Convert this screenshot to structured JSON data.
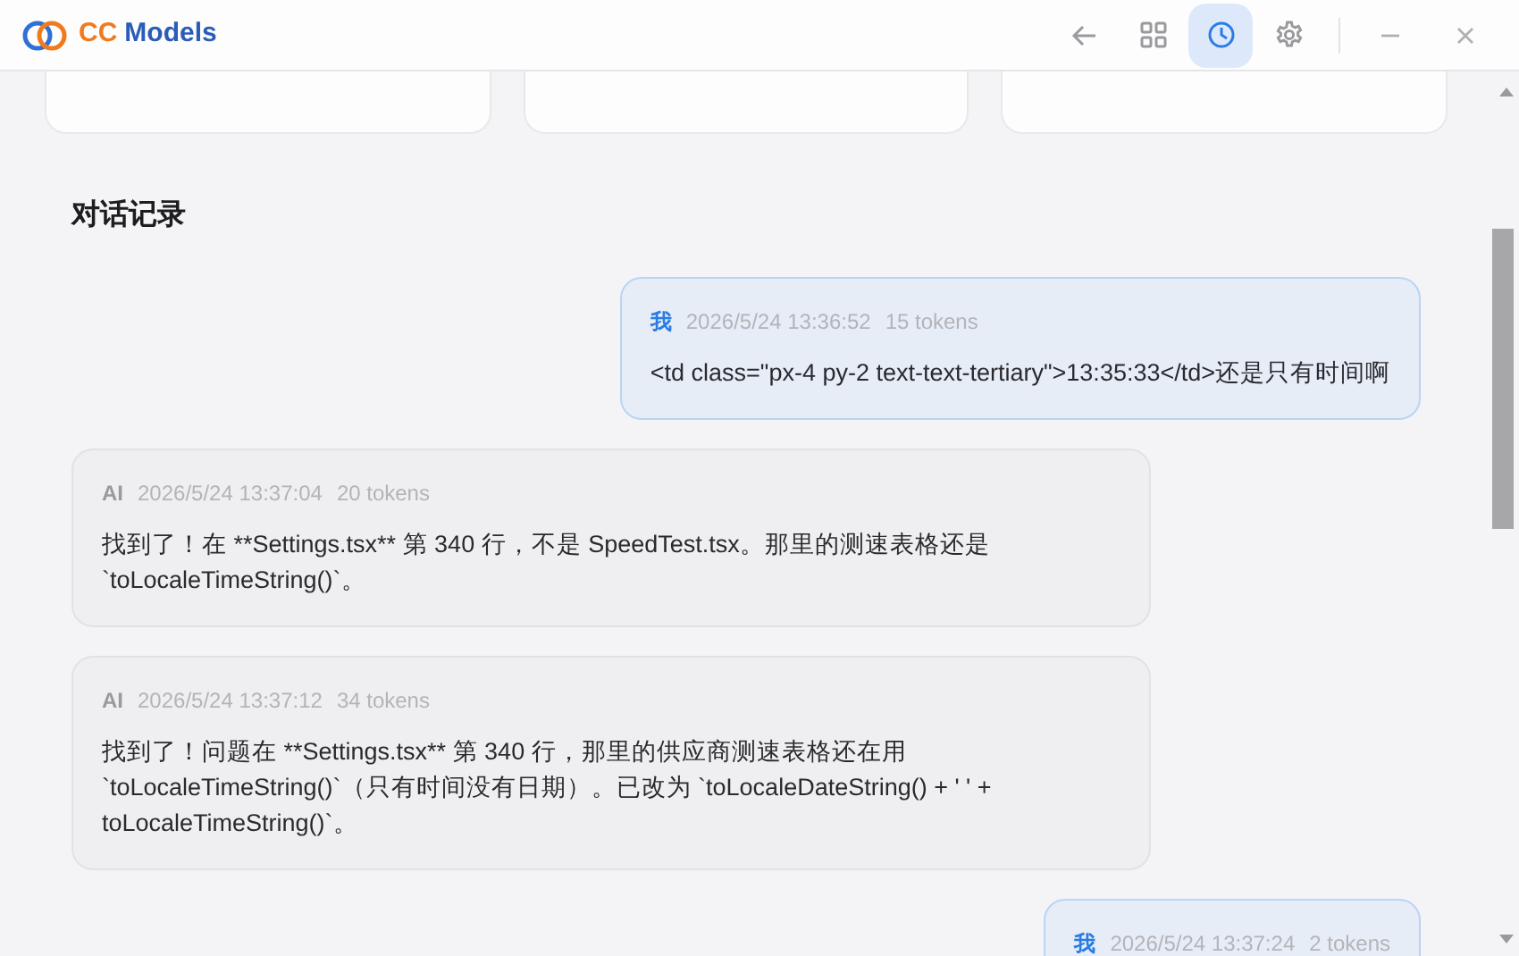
{
  "app": {
    "title_part_1": "CC",
    "title_part_2": "Models"
  },
  "toolbar": [
    {
      "kind": "grid",
      "selected": false
    },
    {
      "kind": "history",
      "selected": true
    },
    {
      "kind": "settings",
      "selected": false
    }
  ],
  "section_title": "对话记录",
  "messages": [
    {
      "kind": "user",
      "sender": "我",
      "time": "2026/5/24 13:36:52",
      "tokens": "15 tokens",
      "text": "<td class=\"px-4 py-2 text-text-tertiary\">13:35:33</td>还是只有时间啊"
    },
    {
      "kind": "ai",
      "sender": "AI",
      "time": "2026/5/24 13:37:04",
      "tokens": "20 tokens",
      "text": "找到了！在 **Settings.tsx** 第 340 行，不是 SpeedTest.tsx。那里的测速表格还是 `toLocaleTimeString()`。"
    },
    {
      "kind": "ai",
      "sender": "AI",
      "time": "2026/5/24 13:37:12",
      "tokens": "34 tokens",
      "text": "找到了！问题在 **Settings.tsx** 第 340 行，那里的供应商测速表格还在用 `toLocaleTimeString()`（只有时间没有日期）。已改为 `toLocaleDateString() + ' ' + toLocaleTimeString()`。"
    },
    {
      "kind": "user",
      "sender": "我",
      "time": "2026/5/24 13:37:24",
      "tokens": "2 tokens"
    }
  ]
}
